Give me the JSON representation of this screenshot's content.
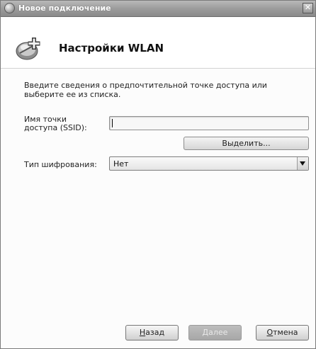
{
  "window": {
    "title": "Новое подключение",
    "close_glyph": "✕"
  },
  "header": {
    "title": "Настройки WLAN",
    "icon": "network-connection-plus-icon"
  },
  "main": {
    "intro": "Введите сведения о предпочтительной точке доступа или выберите ее из списка.",
    "ssid": {
      "label": "Имя точки доступа (SSID):",
      "value": ""
    },
    "select_button_label": "Выделить...",
    "encryption": {
      "label": "Тип шифрования:",
      "selected": "Нет"
    }
  },
  "footer": {
    "back_mnemonic": "Н",
    "back_rest": "азад",
    "next_label": "Далее",
    "cancel_mnemonic": "О",
    "cancel_rest": "тмена"
  },
  "colors": {
    "titlebar": "#9c9c9c",
    "disabled_button": "#b2b2b2"
  }
}
